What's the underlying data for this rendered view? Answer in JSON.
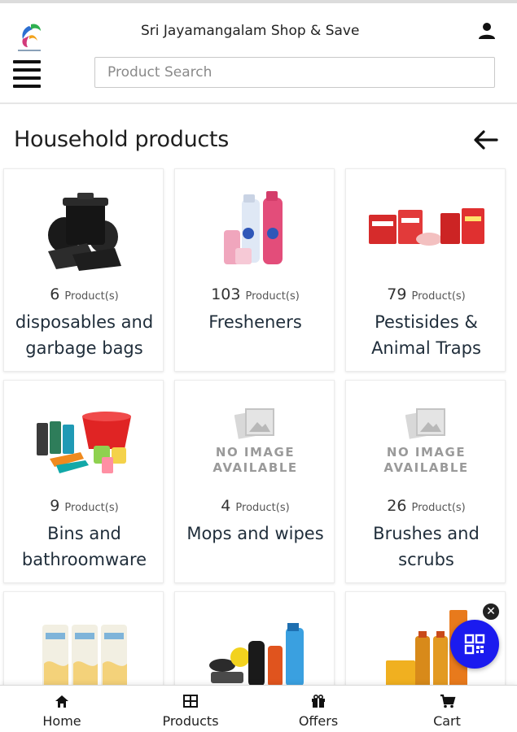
{
  "header": {
    "shop_name": "Sri Jayamangalam Shop & Save",
    "search_placeholder": "Product Search"
  },
  "page": {
    "title": "Household products"
  },
  "categories": [
    {
      "count": "6",
      "unit": "Product(s)",
      "name": "disposables and garbage bags",
      "image": "garbage-bags"
    },
    {
      "count": "103",
      "unit": "Product(s)",
      "name": "Fresheners",
      "image": "fresheners"
    },
    {
      "count": "79",
      "unit": "Product(s)",
      "name": "Pestisides & Animal Traps",
      "image": "pesticides"
    },
    {
      "count": "9",
      "unit": "Product(s)",
      "name": "Bins and bathroomware",
      "image": "bins"
    },
    {
      "count": "4",
      "unit": "Product(s)",
      "name": "Mops and wipes",
      "image": "no-image"
    },
    {
      "count": "26",
      "unit": "Product(s)",
      "name": "Brushes and scrubs",
      "image": "no-image"
    },
    {
      "image": "tissue-rolls"
    },
    {
      "image": "car-care"
    },
    {
      "image": "oil-bottles"
    }
  ],
  "no_image_text": [
    "NO IMAGE",
    "AVAILABLE"
  ],
  "bottom_nav": {
    "home": "Home",
    "products": "Products",
    "offers": "Offers",
    "cart": "Cart"
  },
  "colors": {
    "fab": "#1b1bef",
    "text": "#1f2d3a"
  }
}
